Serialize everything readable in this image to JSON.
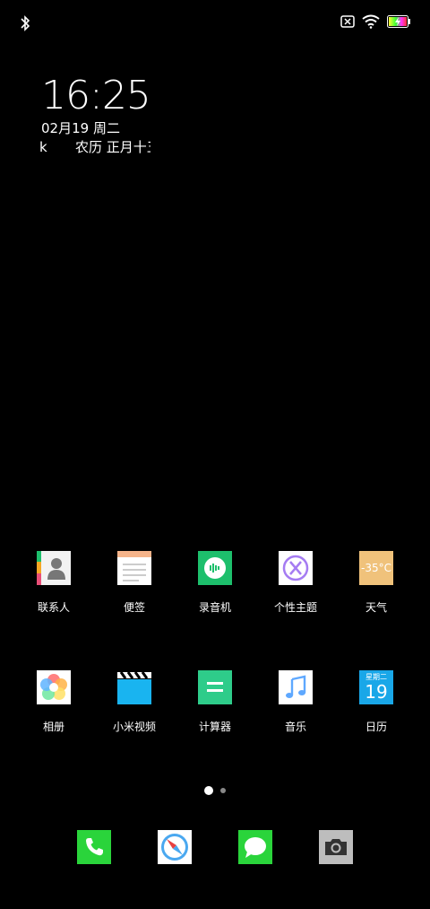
{
  "status_bar": {
    "bluetooth": "bluetooth-icon",
    "sim": "no-sim-icon",
    "wifi": "wifi-icon",
    "battery": "battery-charging-icon"
  },
  "lockclock": {
    "time": "16:25",
    "date": "02月19 周二",
    "lunar_prefix": "k",
    "lunar": "农历 正月十五"
  },
  "apps_row1": [
    {
      "label": "联系人"
    },
    {
      "label": "便签"
    },
    {
      "label": "录音机"
    },
    {
      "label": "个性主题"
    },
    {
      "label": "天气",
      "icon_text": "-35°C"
    }
  ],
  "apps_row2": [
    {
      "label": "相册"
    },
    {
      "label": "小米视频"
    },
    {
      "label": "计算器"
    },
    {
      "label": "音乐"
    },
    {
      "label": "日历",
      "icon_weekday": "星期二",
      "icon_day": "19"
    }
  ],
  "dock": [
    {
      "name": "phone-icon"
    },
    {
      "name": "browser-icon"
    },
    {
      "name": "messages-icon"
    },
    {
      "name": "camera-icon"
    }
  ],
  "colors": {
    "background": "#000000",
    "recorder": "#1dbf6c",
    "calculator": "#2ecc8a",
    "weather": "#f0c27b",
    "calendar": "#19a7e8",
    "phone": "#2ad43b",
    "messages": "#2ad43b"
  }
}
